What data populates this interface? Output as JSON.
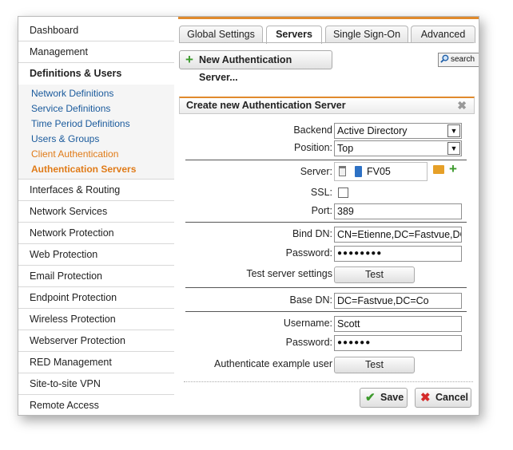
{
  "sidebar": {
    "items_top": [
      {
        "label": "Dashboard"
      },
      {
        "label": "Management"
      }
    ],
    "active_section": "Definitions & Users",
    "sub_items": [
      {
        "label": "Network Definitions"
      },
      {
        "label": "Service Definitions"
      },
      {
        "label": "Time Period Definitions"
      },
      {
        "label": "Users & Groups"
      },
      {
        "label": "Client Authentication"
      },
      {
        "label": "Authentication Servers"
      }
    ],
    "items_bottom": [
      {
        "label": "Interfaces & Routing"
      },
      {
        "label": "Network Services"
      },
      {
        "label": "Network Protection"
      },
      {
        "label": "Web Protection"
      },
      {
        "label": "Email Protection"
      },
      {
        "label": "Endpoint Protection"
      },
      {
        "label": "Wireless Protection"
      },
      {
        "label": "Webserver Protection"
      },
      {
        "label": "RED Management"
      },
      {
        "label": "Site-to-site VPN"
      },
      {
        "label": "Remote Access"
      }
    ]
  },
  "tabs": [
    {
      "label": "Global Settings"
    },
    {
      "label": "Servers"
    },
    {
      "label": "Single Sign-On"
    },
    {
      "label": "Advanced"
    }
  ],
  "toolbar": {
    "new_label": "New Authentication Server...",
    "search_label": "search"
  },
  "panel": {
    "title": "Create new Authentication Server",
    "close_glyph": "✖",
    "backend": {
      "label": "Backend",
      "value": "Active Directory"
    },
    "position": {
      "label": "Position:",
      "value": "Top"
    },
    "server": {
      "label": "Server:",
      "value": "FV05"
    },
    "ssl": {
      "label": "SSL:"
    },
    "port": {
      "label": "Port:",
      "value": "389"
    },
    "bind_dn": {
      "label": "Bind DN:",
      "value": "CN=Etienne,DC=Fastvue,DC"
    },
    "password1": {
      "label": "Password:",
      "value": "●●●●●●●●"
    },
    "test_server": {
      "label": "Test server settings",
      "button": "Test"
    },
    "base_dn": {
      "label": "Base DN:",
      "value": "DC=Fastvue,DC=Co"
    },
    "username": {
      "label": "Username:",
      "value": "Scott"
    },
    "password2": {
      "label": "Password:",
      "value": "●●●●●●"
    },
    "auth_example": {
      "label": "Authenticate example user",
      "button": "Test"
    },
    "save_label": "Save",
    "cancel_label": "Cancel"
  },
  "colors": {
    "accent_orange": "#e08a2c",
    "link_blue": "#1a5a9c",
    "green": "#3c9a2c",
    "red": "#d42a2a"
  }
}
